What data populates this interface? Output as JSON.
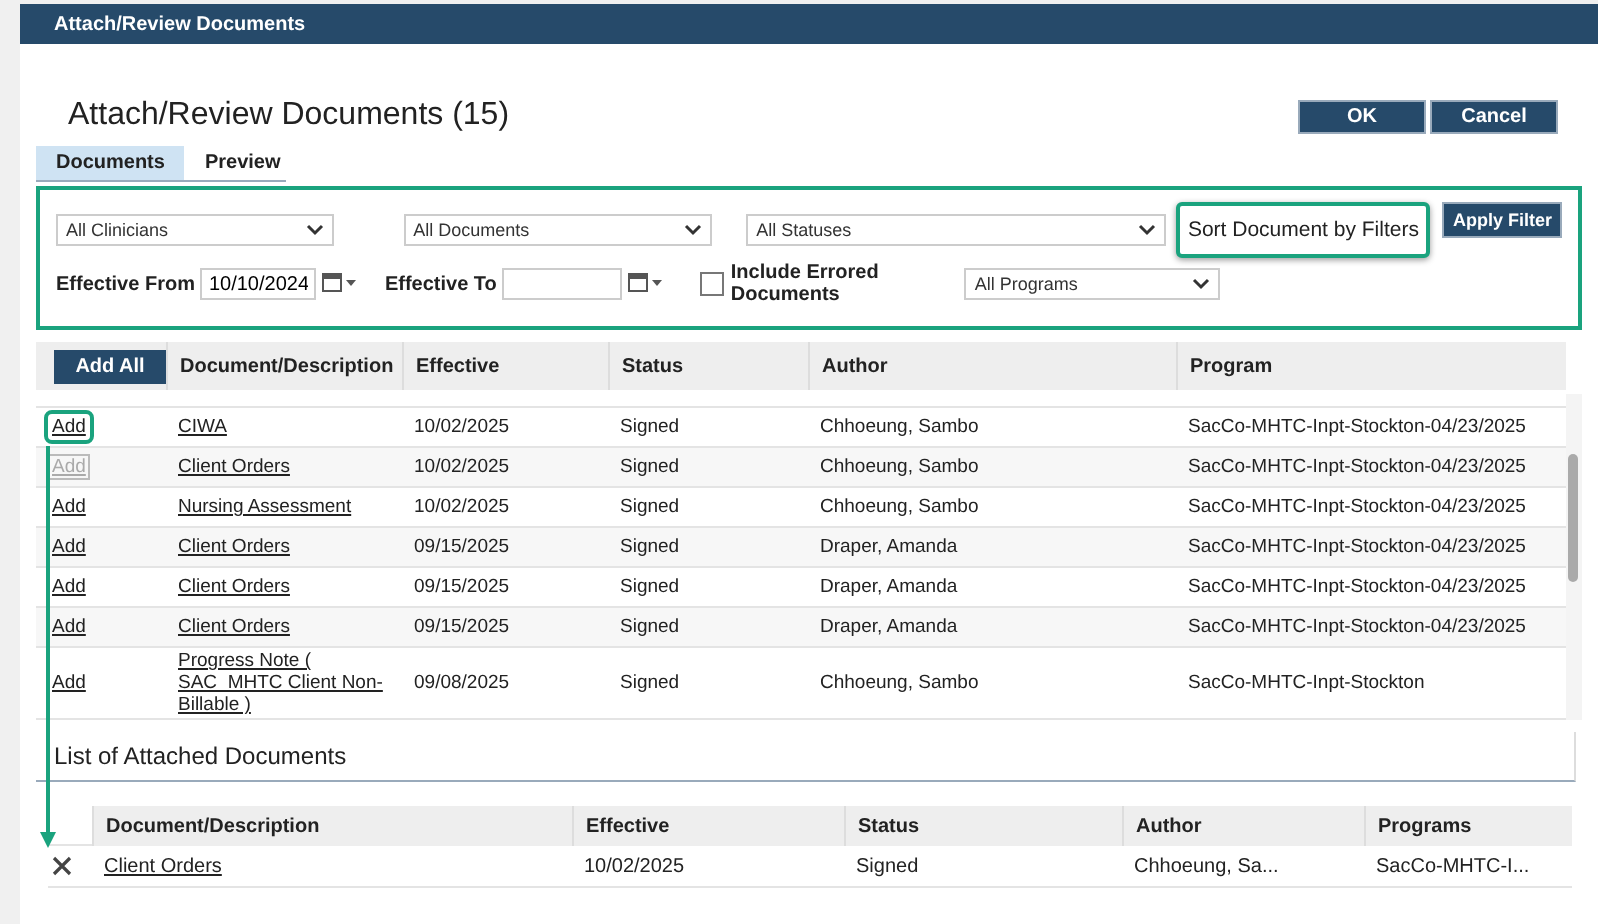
{
  "window": {
    "title": "Attach/Review Documents"
  },
  "heading": "Attach/Review Documents (15)",
  "buttons": [
    {
      "label": "OK"
    },
    {
      "label": "Cancel"
    }
  ],
  "tabs": [
    {
      "label": "Documents",
      "selected": true
    },
    {
      "label": "Preview",
      "selected": false
    }
  ],
  "filters": {
    "clinician": "All Clinicians",
    "document": "All Documents",
    "status": "All Statuses",
    "effective_from_label": "Effective From",
    "effective_from": "10/10/2024",
    "effective_to_label": "Effective To",
    "include_errored": {
      "label": "Include Errored Documents",
      "checked": false
    },
    "program": "All Programs",
    "apply": "Apply Filter"
  },
  "callout": "Sort Document by Filters",
  "documents": {
    "add_all": "Add All",
    "columns": [
      "Document/Description",
      "Effective",
      "Status",
      "Author",
      "Program"
    ],
    "rows": [
      {
        "add": "Add",
        "disabled": false,
        "highlighted": true,
        "document": "CIWA",
        "effective": "10/02/2025",
        "status": "Signed",
        "author": "Chhoeung, Sambo",
        "program": "SacCo-MHTC-Inpt-Stockton-04/23/2025"
      },
      {
        "add": "Add",
        "disabled": true,
        "highlighted": false,
        "document": "Client Orders",
        "effective": "10/02/2025",
        "status": "Signed",
        "author": "Chhoeung, Sambo",
        "program": "SacCo-MHTC-Inpt-Stockton-04/23/2025"
      },
      {
        "add": "Add",
        "disabled": false,
        "highlighted": false,
        "document": "Nursing Assessment",
        "effective": "10/02/2025",
        "status": "Signed",
        "author": "Chhoeung, Sambo",
        "program": "SacCo-MHTC-Inpt-Stockton-04/23/2025"
      },
      {
        "add": "Add",
        "disabled": false,
        "highlighted": false,
        "document": "Client Orders",
        "effective": "09/15/2025",
        "status": "Signed",
        "author": "Draper, Amanda",
        "program": "SacCo-MHTC-Inpt-Stockton-04/23/2025"
      },
      {
        "add": "Add",
        "disabled": false,
        "highlighted": false,
        "document": "Client Orders",
        "effective": "09/15/2025",
        "status": "Signed",
        "author": "Draper, Amanda",
        "program": "SacCo-MHTC-Inpt-Stockton-04/23/2025"
      },
      {
        "add": "Add",
        "disabled": false,
        "highlighted": false,
        "document": "Client Orders",
        "effective": "09/15/2025",
        "status": "Signed",
        "author": "Draper, Amanda",
        "program": "SacCo-MHTC-Inpt-Stockton-04/23/2025"
      },
      {
        "add": "Add",
        "disabled": false,
        "highlighted": false,
        "document": "Progress Note ( SAC_MHTC Client Non-Billable )",
        "effective": "09/08/2025",
        "status": "Signed",
        "author": "Chhoeung, Sambo",
        "program": "SacCo-MHTC-Inpt-Stockton"
      }
    ]
  },
  "attached": {
    "title": "List of Attached Documents",
    "columns": [
      "Document/Description",
      "Effective",
      "Status",
      "Author",
      "Programs"
    ],
    "rows": [
      {
        "document": "Client Orders",
        "effective": "10/02/2025",
        "status": "Signed",
        "author": "Chhoeung, Sa...",
        "program": "SacCo-MHTC-I..."
      }
    ]
  }
}
